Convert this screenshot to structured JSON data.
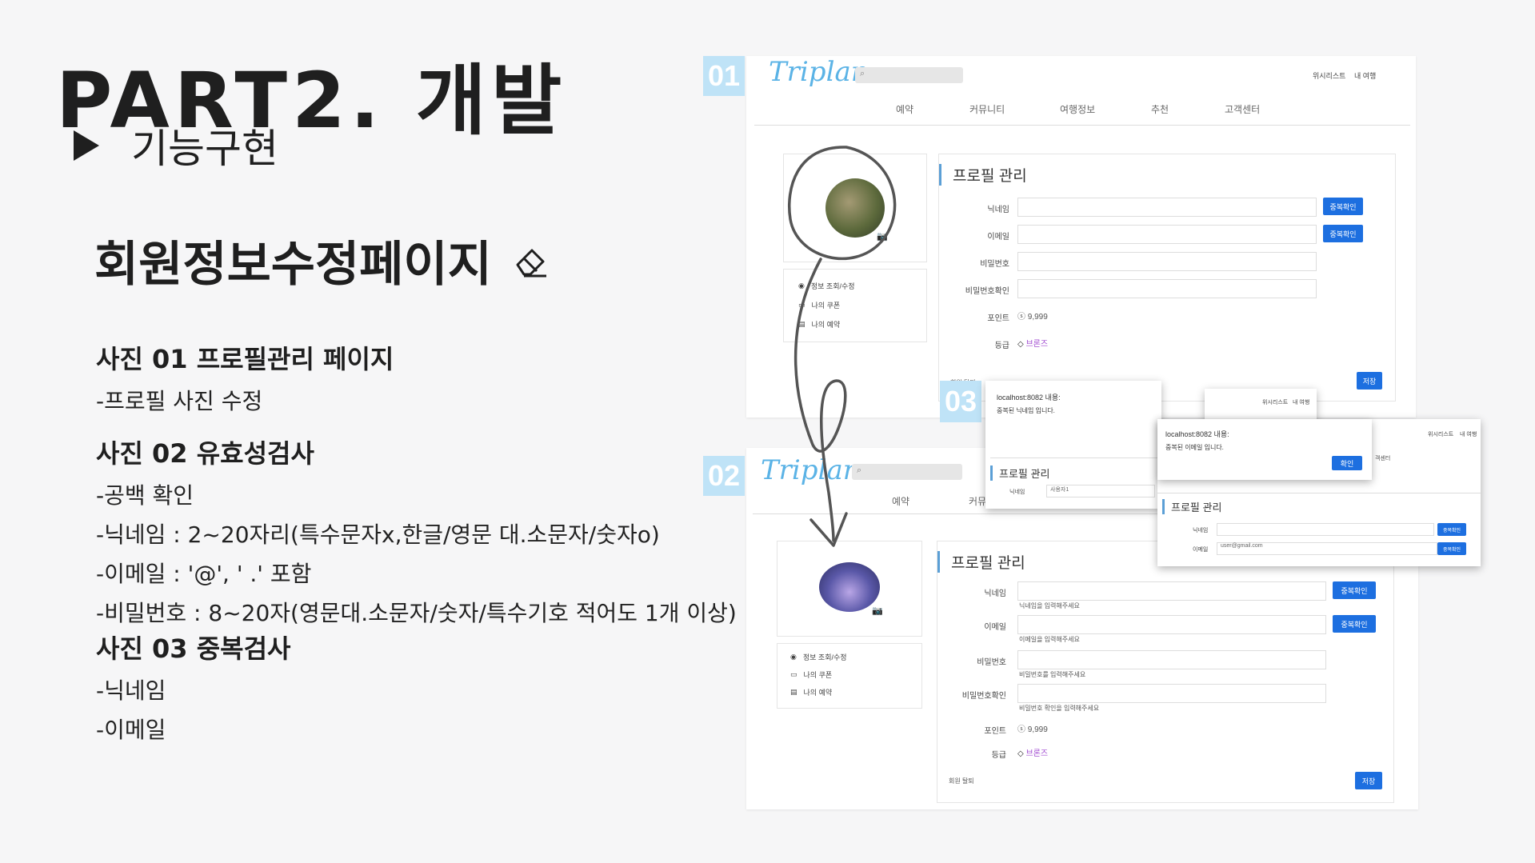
{
  "heading": {
    "part": "PART2. 개발",
    "sub": "기능구현",
    "page": "회원정보수정페이지"
  },
  "sections": [
    {
      "title": "사진 01 프로필관리 페이지",
      "lines": [
        "-프로필 사진 수정"
      ]
    },
    {
      "title": "사진 02 유효성검사",
      "lines": [
        "-공백 확인",
        "-닉네임 : 2~20자리(특수문자x,한글/영문 대.소문자/숫자o)",
        "-이메일 : '@', ' .' 포함",
        "-비밀번호 : 8~20자(영문대.소문자/숫자/특수기호 적어도 1개 이상)"
      ]
    },
    {
      "title": "사진 03 중복검사",
      "lines": [
        "-닉네임",
        "-이메일"
      ]
    }
  ],
  "badges": [
    "01",
    "02",
    "03"
  ],
  "app": {
    "logo": "Triplan",
    "top_links": [
      "위시리스트",
      "내 여행"
    ],
    "nav": [
      "예약",
      "커뮤니티",
      "여행정보",
      "추천",
      "고객센터"
    ],
    "menu": [
      "정보 조회/수정",
      "나의 쿠폰",
      "나의 예약"
    ],
    "profile_title": "프로필 관리",
    "labels": {
      "nickname": "닉네임",
      "email": "이메일",
      "password": "비밀번호",
      "password_confirm": "비밀번호확인",
      "point": "포인트",
      "grade": "등급"
    },
    "dup_button": "중복확인",
    "point_value": "9,999",
    "grade_value": "브론즈",
    "withdraw": "회원 탈퇴",
    "save": "저장",
    "hints": [
      "닉네임을 입력해주세요",
      "이메일을 입력해주세요",
      "비밀번호를 입력해주세요",
      "비밀번호 확인을 입력해주세요"
    ]
  },
  "dialogs": {
    "origin": "localhost:8082 내용:",
    "nick_dup": "중복된 닉네임 입니다.",
    "email_dup": "중복된 이메일 입니다.",
    "ok": "확인",
    "nick_value": "사용자1",
    "email_value": "user@gmail.com",
    "center_fragment": "객센터",
    "community_fragment": "커뮤"
  },
  "colors": {
    "accent": "#1d6fe0",
    "badge": "#bfe3f7",
    "logo": "#5bb3e6",
    "grade": "#a04ad0"
  }
}
